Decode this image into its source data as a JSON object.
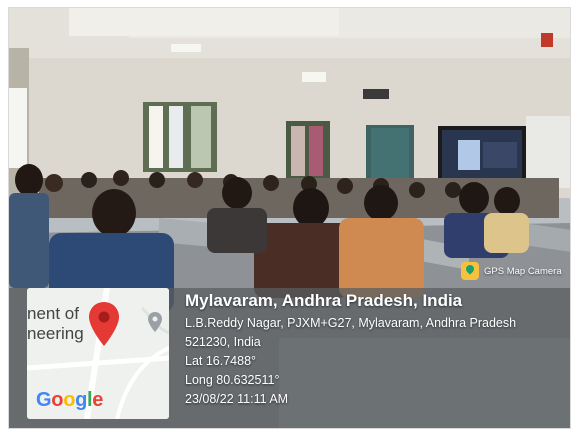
{
  "map": {
    "fragment_line1": "nent of",
    "fragment_line2": "neering",
    "logo_letters": [
      {
        "char": "G",
        "color": "#4285F4"
      },
      {
        "char": "o",
        "color": "#EA4335"
      },
      {
        "char": "o",
        "color": "#FBBC05"
      },
      {
        "char": "g",
        "color": "#4285F4"
      },
      {
        "char": "l",
        "color": "#34A853"
      },
      {
        "char": "e",
        "color": "#EA4335"
      }
    ],
    "pin_color": "#E53935"
  },
  "location": {
    "title": "Mylavaram, Andhra Pradesh, India",
    "address_line1": "L.B.Reddy Nagar, PJXM+G27, Mylavaram, Andhra Pradesh",
    "address_line2": "521230, India",
    "latitude": "Lat 16.7488°",
    "longitude": "Long 80.632511°",
    "datetime": "23/08/22 11:11 AM"
  },
  "app_badge": {
    "label": "GPS Map Camera",
    "icon": "map-pin-app-icon"
  }
}
